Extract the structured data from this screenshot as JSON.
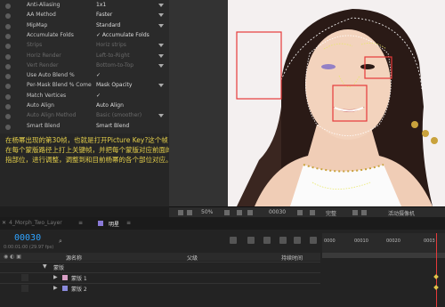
{
  "fx_rows": [
    {
      "label": "Anti-Aliasing",
      "value": "1x1",
      "dim": false,
      "dd": true
    },
    {
      "label": "AA Method",
      "value": "Faster",
      "dim": false,
      "dd": true
    },
    {
      "label": "MipMap",
      "value": "Standard",
      "dim": false,
      "dd": true
    },
    {
      "label": "Accumulate Folds",
      "value": "✓ Accumulate Folds",
      "dim": false,
      "dd": false
    },
    {
      "label": "Strips",
      "value": "Horiz strips",
      "dim": true,
      "dd": true
    },
    {
      "label": "Horiz Render",
      "value": "Left-to-Right",
      "dim": true,
      "dd": true
    },
    {
      "label": "Vert Render",
      "value": "Bottom-to-Top",
      "dim": true,
      "dd": true
    },
    {
      "label": "Use Auto Blend %",
      "value": "✓",
      "dim": false,
      "dd": false
    },
    {
      "label": "Per-Mask Blend % Come",
      "value": "Mask Opacity",
      "dim": false,
      "dd": true
    },
    {
      "label": "Match Vertices",
      "value": "✓",
      "dim": false,
      "dd": false
    },
    {
      "label": "Auto Align",
      "value": "Auto Align",
      "dim": false,
      "dd": false
    },
    {
      "label": "Auto Align Method",
      "value": "Basic (smoother)",
      "dim": true,
      "dd": true
    },
    {
      "label": "Smart Blend",
      "value": "Smart Blend",
      "dim": false,
      "dd": false
    }
  ],
  "caption": {
    "line1": "在杨幂出现的第30帧，也就是打开Picture Key?这个帧",
    "line2": "在每个蒙版路径上打上关键帧，并把每个蒙版对应前面的蒙版所",
    "line3": "指部位，进行调整，调整到和目前杨幂的各个部位对应。"
  },
  "viewer_bar": {
    "zoom": "50%",
    "timecode": "00030",
    "quality": "完整",
    "camera": "活动摄像机"
  },
  "tabs": [
    {
      "label": "4_Morph_Two_Layer"
    },
    {
      "label": "明星"
    }
  ],
  "timeline": {
    "timecode": "00030",
    "subtime": "0:00:01:00 (29.97 fps)",
    "col_source": "源名称",
    "col_parent": "父级",
    "col_duration": "持续时间",
    "group_label": "蒙版",
    "layers": [
      {
        "name": "蒙版 1",
        "color": "#d79ec4"
      },
      {
        "name": "蒙版 2",
        "color": "#8a8adb"
      }
    ],
    "ruler": [
      "0000",
      "00010",
      "00020",
      "0003"
    ]
  }
}
